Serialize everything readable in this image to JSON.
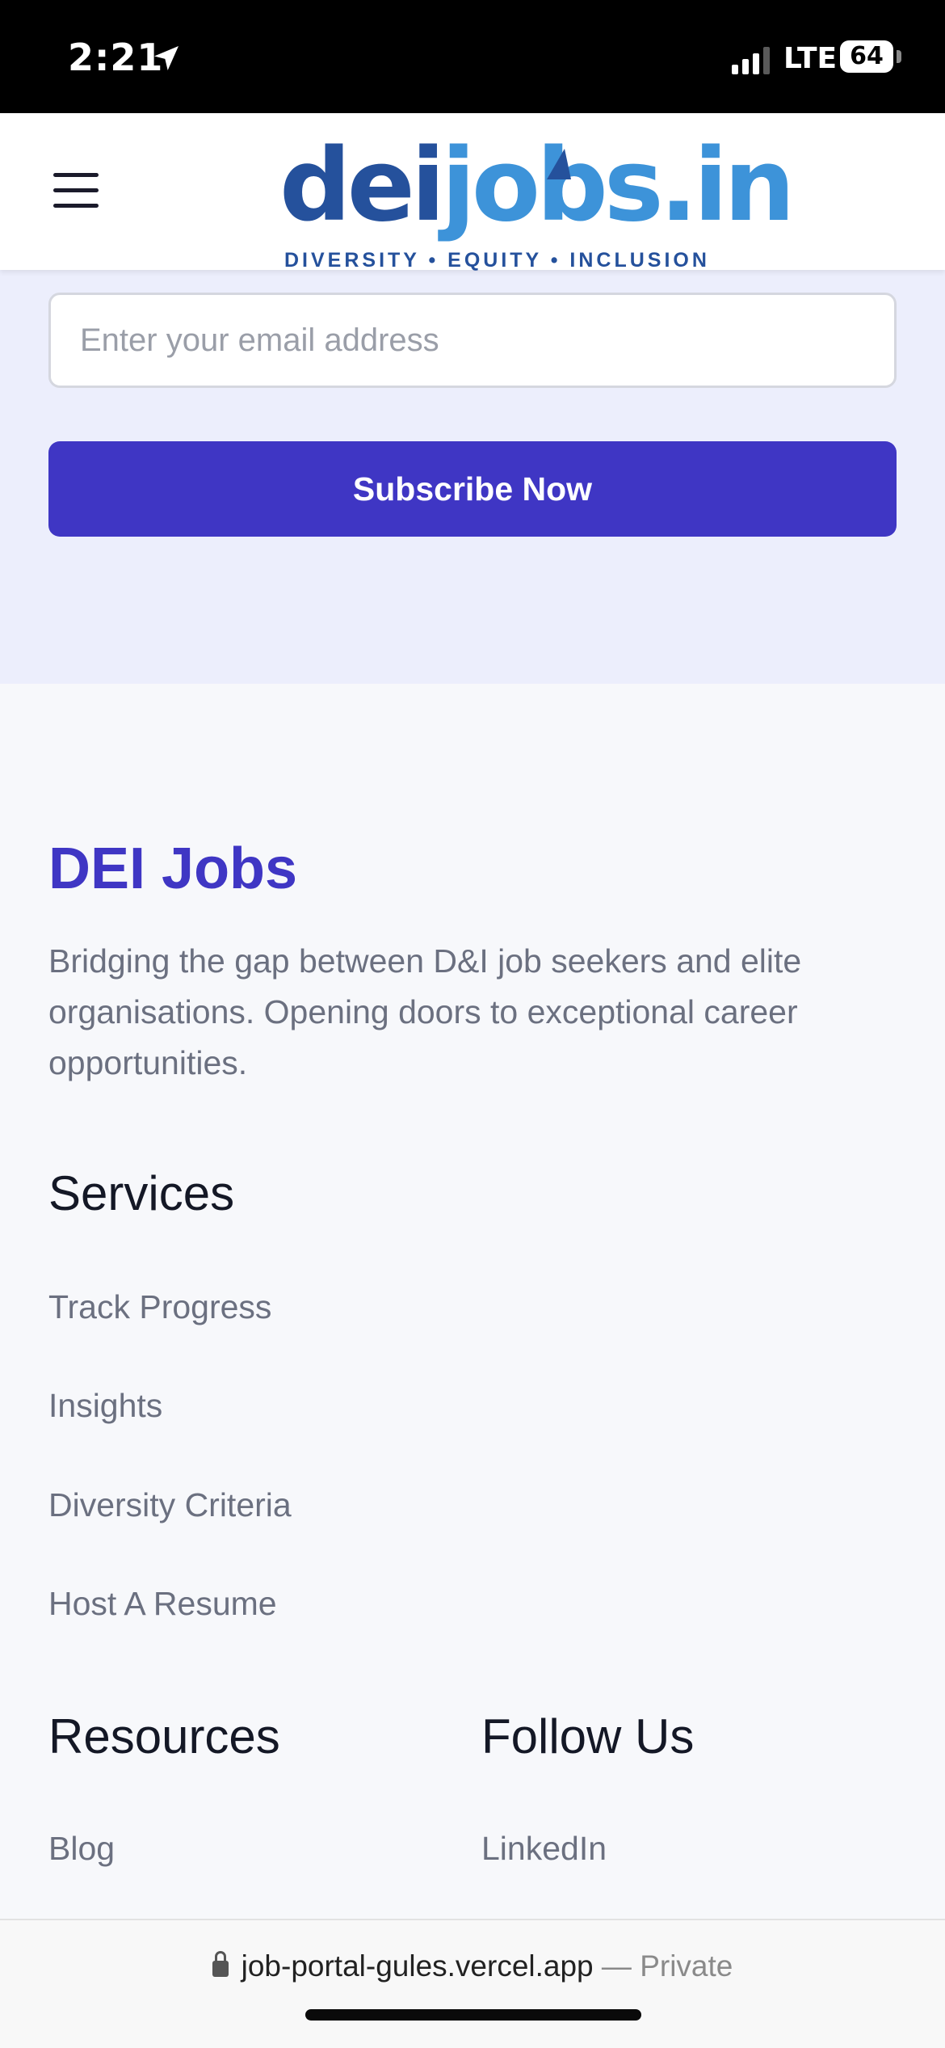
{
  "status_bar": {
    "time": "2:21",
    "network": "LTE",
    "battery": "64"
  },
  "header": {
    "logo": {
      "dei_part": "dei",
      "jobs_part": "jobs.in",
      "tagline": "DIVERSITY • EQUITY • INCLUSION"
    }
  },
  "newsletter": {
    "email_placeholder": "Enter your email address",
    "subscribe_label": "Subscribe Now"
  },
  "footer": {
    "brand_title": "DEI Jobs",
    "brand_description": "Bridging the gap between D&I job seekers and elite organisations. Opening doors to exceptional career opportunities.",
    "services": {
      "heading": "Services",
      "links": [
        "Track Progress",
        "Insights",
        "Diversity Criteria",
        "Host A Resume"
      ]
    },
    "resources": {
      "heading": "Resources",
      "links": [
        "Blog"
      ]
    },
    "follow_us": {
      "heading": "Follow Us",
      "links": [
        "LinkedIn"
      ]
    }
  },
  "browser": {
    "url": "job-portal-gules.vercel.app",
    "mode": "— Private"
  },
  "colors": {
    "brand_purple": "#3f36c4",
    "logo_dark_blue": "#25519c",
    "logo_light_blue": "#3d93d9",
    "newsletter_bg": "#eceefc"
  }
}
